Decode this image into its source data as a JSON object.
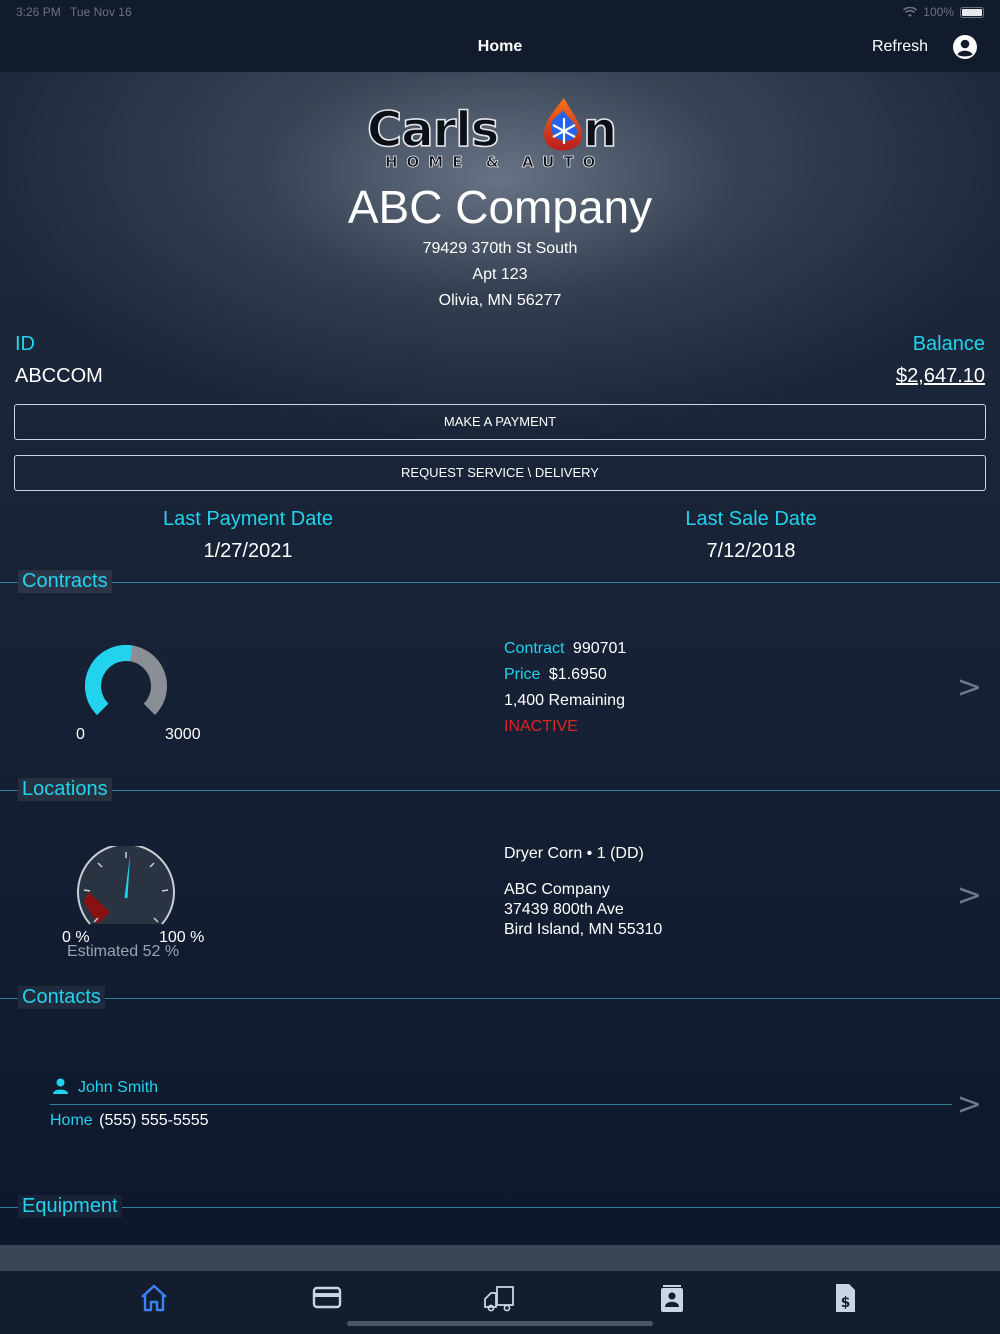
{
  "status": {
    "time": "3:26 PM",
    "date": "Tue Nov 16",
    "battery": "100%"
  },
  "nav": {
    "title": "Home",
    "refresh": "Refresh"
  },
  "logo": {
    "brand": "Carlson",
    "tagline": "HOME & AUTO"
  },
  "company": {
    "name": "ABC Company",
    "address1": "79429 370th St South",
    "address2": "Apt 123",
    "address3": "Olivia, MN 56277"
  },
  "account": {
    "id_label": "ID",
    "id_value": "ABCCOM",
    "balance_label": "Balance",
    "balance_value": "$2,647.10"
  },
  "buttons": {
    "make_payment": "MAKE A PAYMENT",
    "request_service": "REQUEST SERVICE \\ DELIVERY"
  },
  "dates": {
    "last_payment_label": "Last Payment Date",
    "last_payment_value": "1/27/2021",
    "last_sale_label": "Last Sale Date",
    "last_sale_value": "7/12/2018"
  },
  "contracts": {
    "section_label": "Contracts",
    "gauge_min": "0",
    "gauge_max": "3000",
    "gauge_fill_fraction": 0.533,
    "contract_label": "Contract",
    "contract_value": "990701",
    "price_label": "Price",
    "price_value": "$1.6950",
    "remaining": "1,400 Remaining",
    "status": "INACTIVE",
    "chevron": ">"
  },
  "locations": {
    "section_label": "Locations",
    "gauge_min": "0 %",
    "gauge_max": "100 %",
    "estimated": "Estimated 52 %",
    "estimated_percent": 52,
    "name": "Dryer Corn • 1 (DD)",
    "addr_name": "ABC Company",
    "addr_street": "37439 800th Ave",
    "addr_city": "Bird Island, MN  55310",
    "chevron": ">"
  },
  "contacts": {
    "section_label": "Contacts",
    "name": "John Smith",
    "phone_label": "Home",
    "phone_value": "(555) 555-5555",
    "chevron": ">"
  },
  "equipment": {
    "section_label": "Equipment"
  },
  "tabs": [
    {
      "icon": "home-icon",
      "active": true
    },
    {
      "icon": "credit-card-icon",
      "active": false
    },
    {
      "icon": "truck-icon",
      "active": false
    },
    {
      "icon": "contact-card-icon",
      "active": false
    },
    {
      "icon": "invoice-icon",
      "active": false
    }
  ],
  "colors": {
    "accent": "#22d3ee",
    "active_tab": "#3b82f6",
    "inactive": "#dc2626"
  }
}
